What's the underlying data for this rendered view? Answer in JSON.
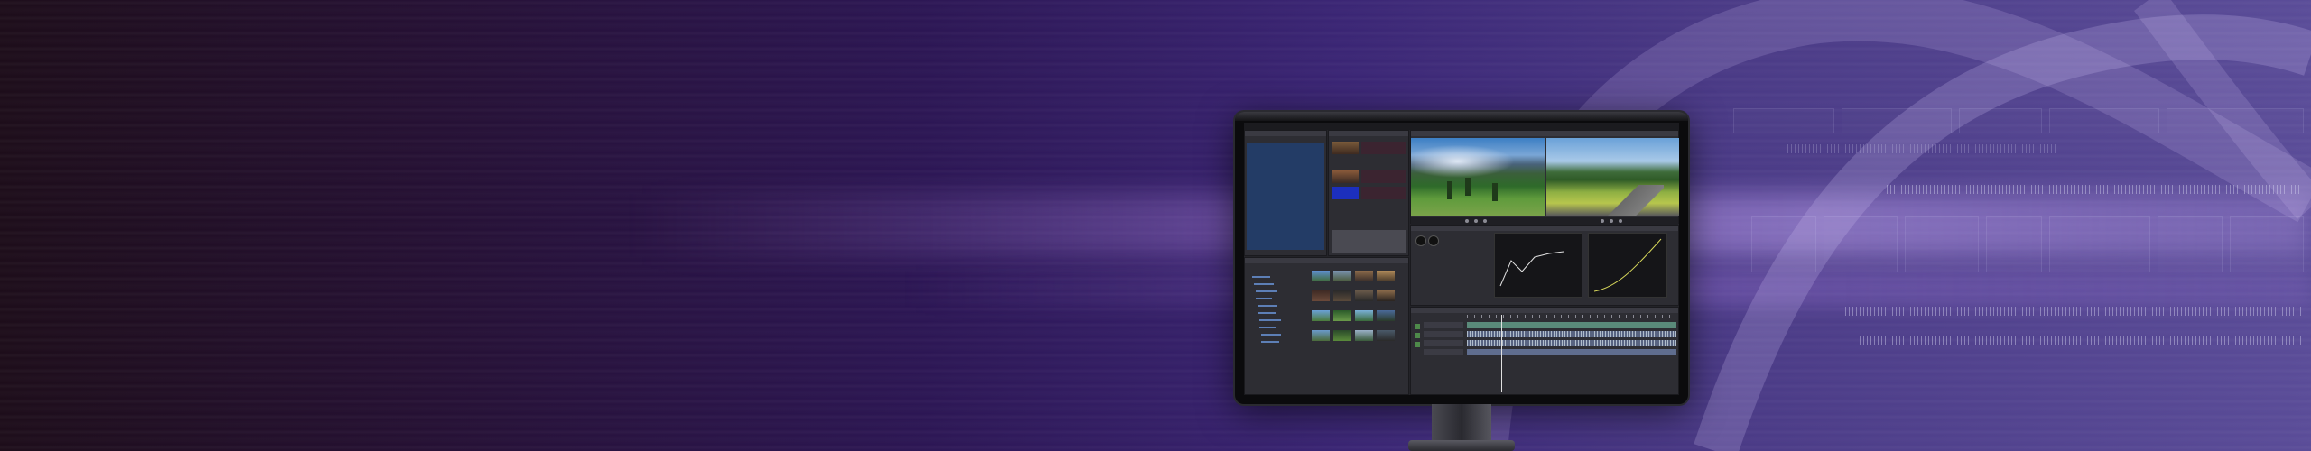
{
  "colors": {
    "background_dark": "#1d0d1a",
    "background_purple": "#2c1654",
    "background_light": "#5a4c98",
    "monitor_bezel": "#0b0b0d",
    "ui_panel": "#2d2d33",
    "ui_blue": "#233c66"
  },
  "icons": [
    "monitor",
    "audio-waveform",
    "video-timeline",
    "arc-shape"
  ]
}
